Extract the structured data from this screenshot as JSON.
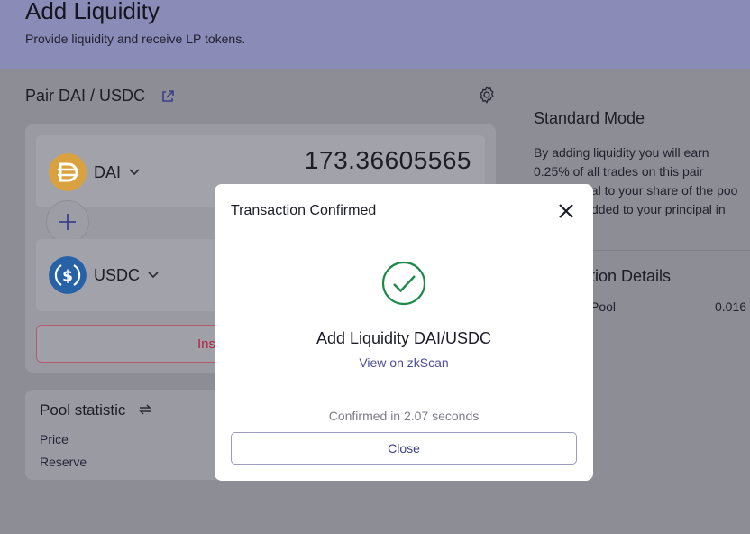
{
  "header": {
    "title": "Add Liquidity",
    "subtitle": "Provide liquidity and receive LP tokens."
  },
  "pair": {
    "label": "Pair DAI / USDC"
  },
  "tokens": [
    {
      "symbol": "DAI",
      "amount": "173.36605565",
      "icon": "dai-icon",
      "color": "#f4b731"
    },
    {
      "symbol": "USDC",
      "amount": "",
      "icon": "usdc-icon",
      "color": "#2775ca"
    }
  ],
  "action_button": {
    "label_partial": "Ins"
  },
  "pool_statistic": {
    "title": "Pool statistic",
    "rows": [
      {
        "label": "Price"
      },
      {
        "label": "Reserve"
      }
    ]
  },
  "side_panel": {
    "title": "Standard Mode",
    "lines": [
      "By adding liquidity you will earn",
      "0.25% of all trades on this pair",
      "nal to your share of the poo",
      "dded to your principal in"
    ],
    "details_title": "ction Details",
    "detail_row": {
      "label": "Pool",
      "value": "0.016"
    }
  },
  "modal": {
    "title": "Transaction Confirmed",
    "main_text": "Add Liquidity DAI/USDC",
    "link_text": "View on zkScan",
    "confirmed_text": "Confirmed in 2.07 seconds",
    "close_label": "Close",
    "accent_color": "#1e8a4a"
  }
}
